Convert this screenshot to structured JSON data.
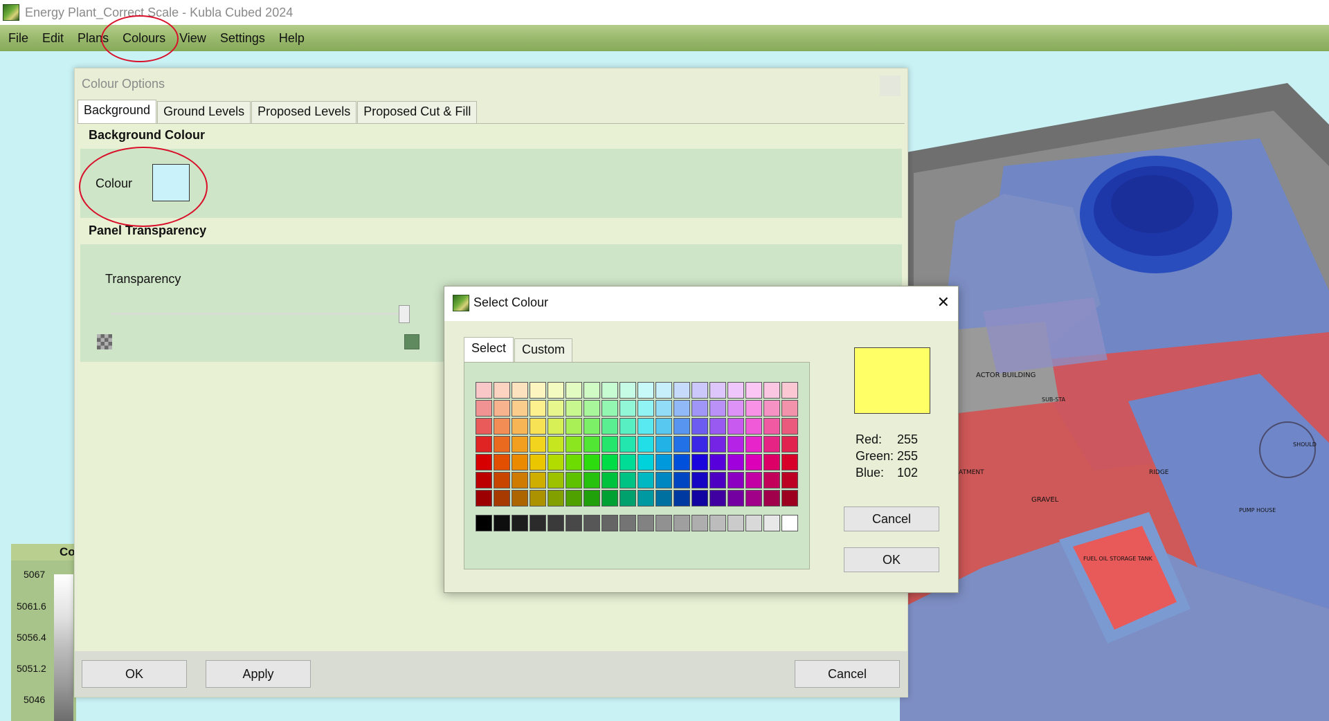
{
  "window": {
    "title": "Energy Plant_Correct Scale - Kubla Cubed 2024"
  },
  "menu": [
    "File",
    "Edit",
    "Plans",
    "Colours",
    "View",
    "Settings",
    "Help"
  ],
  "legend": {
    "header": "Co",
    "ticks": [
      "5067",
      "5061.6",
      "5056.4",
      "5051.2",
      "5046"
    ]
  },
  "colour_options": {
    "title": "Colour Options",
    "tabs": [
      "Background",
      "Ground Levels",
      "Proposed Levels",
      "Proposed Cut & Fill"
    ],
    "active_tab": "Background",
    "background_section": {
      "heading": "Background Colour",
      "colour_label": "Colour",
      "colour_value": "#c9f2fa"
    },
    "transparency_section": {
      "heading": "Panel Transparency",
      "label": "Transparency",
      "slider_level": 1.0
    },
    "buttons": {
      "ok": "OK",
      "apply": "Apply",
      "cancel": "Cancel"
    }
  },
  "select_colour": {
    "title": "Select Colour",
    "close_glyph": "✕",
    "tabs": [
      "Select",
      "Custom"
    ],
    "active_tab": "Select",
    "selected_colour": "#ffff66",
    "rgb": {
      "red_label": "Red:",
      "red": "255",
      "green_label": "Green:",
      "green": "255",
      "blue_label": "Blue:",
      "blue": "102"
    },
    "buttons": {
      "cancel": "Cancel",
      "ok": "OK"
    },
    "palette": [
      [
        "#f9c7c7",
        "#fbd3c0",
        "#fde2bf",
        "#fdf5c0",
        "#f3fbc0",
        "#e2fbc0",
        "#d0fbc4",
        "#c7fbd2",
        "#c6fbe6",
        "#c6f9f8",
        "#c6eefb",
        "#c6dafb",
        "#ccc8fb",
        "#dcc6fb",
        "#efc6fb",
        "#fbc6f3",
        "#fbc6e2",
        "#fbc7d3"
      ],
      [
        "#f19393",
        "#f7b28e",
        "#fbcd8d",
        "#fbef8e",
        "#e7f78e",
        "#c7f78e",
        "#a8f79a",
        "#93f7b2",
        "#92f7d6",
        "#92f3f5",
        "#92dcf7",
        "#92b9f7",
        "#9f96f7",
        "#ba92f7",
        "#dd92f7",
        "#f792e7",
        "#f792c4",
        "#f293ab"
      ],
      [
        "#e95a5a",
        "#f28d55",
        "#f7b555",
        "#f7e155",
        "#d7f055",
        "#a8f055",
        "#7cf066",
        "#5af091",
        "#58f0c2",
        "#58eaf0",
        "#58c8f0",
        "#5895f0",
        "#6d5cf0",
        "#985af0",
        "#c95af0",
        "#f05ad8",
        "#f05aa3",
        "#ea5a7d"
      ],
      [
        "#e02424",
        "#ea6a1f",
        "#f29e1f",
        "#f2d41f",
        "#c6e61f",
        "#8be61f",
        "#52e634",
        "#24e66c",
        "#22e6ad",
        "#22dee6",
        "#22b2e6",
        "#2271e6",
        "#3b28e6",
        "#7524e6",
        "#b524e6",
        "#e624c9",
        "#e62483",
        "#e0244f"
      ],
      [
        "#d60000",
        "#e34f00",
        "#ea8a00",
        "#eac600",
        "#b2dc00",
        "#6ddc00",
        "#2ddc0f",
        "#00dc46",
        "#00dc95",
        "#00d2dc",
        "#009adc",
        "#0050dc",
        "#1a06dc",
        "#5800dc",
        "#a000dc",
        "#dc00b9",
        "#dc0066",
        "#d60029"
      ],
      [
        "#bc0000",
        "#c84500",
        "#cf7a00",
        "#cfae00",
        "#9cc200",
        "#5fc200",
        "#27c20d",
        "#00c23d",
        "#00c283",
        "#00b8c2",
        "#0087c2",
        "#0046c2",
        "#1605c2",
        "#4d00c2",
        "#8c00c2",
        "#c200a3",
        "#c20059",
        "#bc0024"
      ],
      [
        "#9c0000",
        "#a63a00",
        "#ac6500",
        "#ac9100",
        "#82a100",
        "#4fa100",
        "#20a10b",
        "#00a133",
        "#00a16d",
        "#0099a1",
        "#0070a1",
        "#003aa1",
        "#1204a1",
        "#4000a1",
        "#7500a1",
        "#a10088",
        "#a1004a",
        "#9c001e"
      ]
    ],
    "grays": [
      "#000000",
      "#0e0e0e",
      "#1d1d1d",
      "#2b2b2b",
      "#3a3a3a",
      "#484848",
      "#575757",
      "#656565",
      "#747474",
      "#828282",
      "#919191",
      "#9f9f9f",
      "#aeaeae",
      "#bcbcbc",
      "#cbcbcb",
      "#d9d9d9",
      "#e8e8e8",
      "#ffffff"
    ]
  },
  "scene_labels": [
    "ACTOR BUILDING",
    "GRAVEL",
    "PUMP HOUSE",
    "FUEL OIL STORAGE TANK",
    "SUB-STA",
    "RIDGE",
    "ATMENT",
    "SHOULD"
  ]
}
